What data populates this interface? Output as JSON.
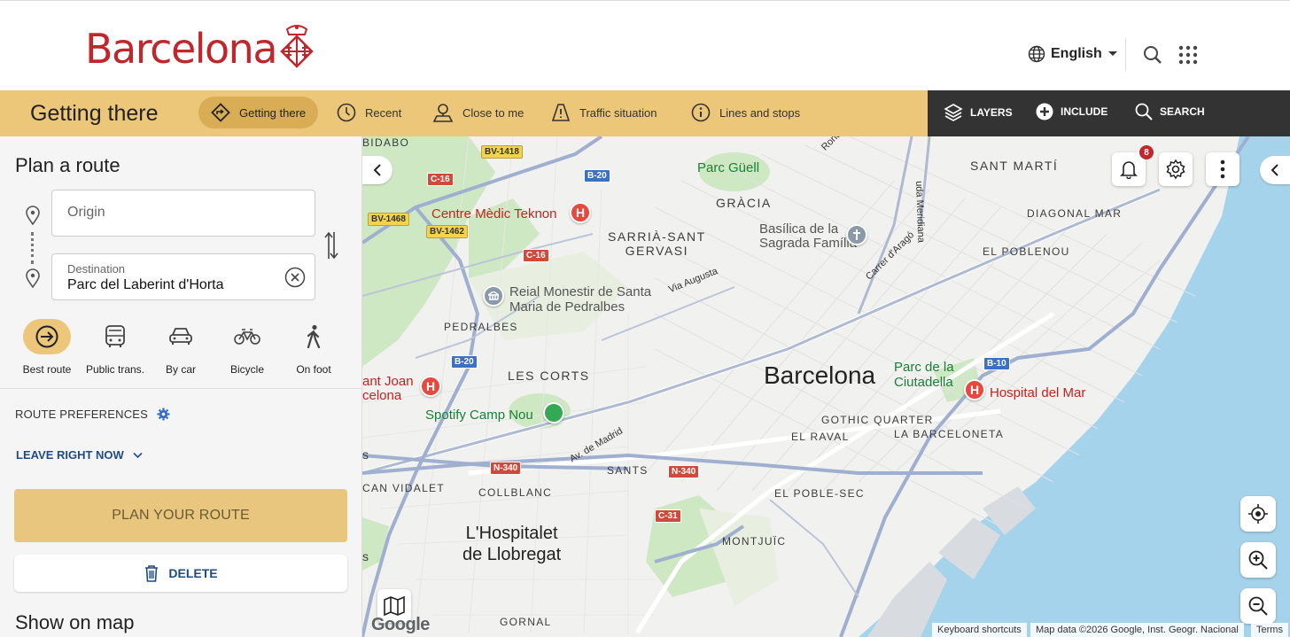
{
  "header": {
    "logo_text": "Barcelona",
    "language": "English"
  },
  "nav": {
    "title": "Getting there",
    "items": [
      {
        "label": "Getting there",
        "icon": "directions-icon",
        "active": true
      },
      {
        "label": "Recent",
        "icon": "clock-icon"
      },
      {
        "label": "Close to me",
        "icon": "person-pin-icon"
      },
      {
        "label": "Traffic situation",
        "icon": "traffic-cone-icon"
      },
      {
        "label": "Lines and stops",
        "icon": "info-icon"
      }
    ],
    "tools": [
      {
        "label": "LAYERS",
        "icon": "layers-icon"
      },
      {
        "label": "INCLUDE",
        "icon": "plus-circle-icon"
      },
      {
        "label": "SEARCH",
        "icon": "search-icon"
      }
    ]
  },
  "panel": {
    "title": "Plan a route",
    "origin_placeholder": "Origin",
    "destination_label": "Destination",
    "destination_value": "Parc del Laberint d'Horta",
    "modes": [
      {
        "label": "Best route",
        "icon": "best-route-icon",
        "active": true
      },
      {
        "label": "Public trans.",
        "icon": "bus-icon"
      },
      {
        "label": "By car",
        "icon": "car-icon"
      },
      {
        "label": "Bicycle",
        "icon": "bicycle-icon"
      },
      {
        "label": "On foot",
        "icon": "walking-icon"
      }
    ],
    "route_preferences": "ROUTE PREFERENCES",
    "leave": "LEAVE RIGHT NOW",
    "plan_button": "PLAN YOUR ROUTE",
    "delete_button": "DELETE",
    "show_on_map": "Show on map"
  },
  "map": {
    "notification_count": "8",
    "labels": {
      "bidabo": "BIDABO",
      "parc_guell": "Parc Güell",
      "ronda": "Ronda del G",
      "meridiana": "uda Meridiana",
      "sant_marti": "SANT MARTÍ",
      "gracia": "GRÀCIA",
      "diagonal_mar": "DIAGONAL MAR",
      "teknon": "Centre Mèdic Teknon",
      "sarria": "SARRIÀ-SANT\nGERVASI",
      "sagrada": "Basílica de la\nSagrada Família",
      "carrer_arago": "Carrer d'Aragó",
      "poblenou": "EL POBLENOU",
      "monestir": "Reial Monestir de Santa\nMaria de Pedralbes",
      "via_augusta": "Via Augusta",
      "pedralbes": "PEDRALBES",
      "les_corts": "LES CORTS",
      "barcelona": "Barcelona",
      "ciutadella": "Parc de la\nCiutadella",
      "hospital_mar": "Hospital del Mar",
      "sant_joan": "ant Joan\ncelona",
      "camp_nou": "Spotify Camp Nou",
      "av_madrid": "Av. de Madrid",
      "gothic": "GOTHIC QUARTER",
      "raval": "EL RAVAL",
      "barceloneta": "LA BARCELONETA",
      "s_left": "s",
      "sants": "SANTS",
      "can_vidalet": "CAN VIDALET",
      "collblanc": "COLLBLANC",
      "poble_sec": "EL POBLE-SEC",
      "hospitalet": "L'Hospitalet\nde Llobregat",
      "montjuic": "MONTJUÏC",
      "s_left2": "s",
      "gornal": "GORNAL"
    },
    "shields": {
      "bv1418": "BV-1418",
      "c16a": "C-16",
      "b20a": "B-20",
      "bv1468": "BV-1468",
      "bv1462": "BV-1462",
      "c16b": "C-16",
      "b20b": "B-20",
      "b10": "B-10",
      "n340a": "N-340",
      "n340b": "N-340",
      "c31": "C-31"
    },
    "google": "Google",
    "attribution": {
      "shortcuts": "Keyboard shortcuts",
      "data": "Map data ©2026 Google, Inst. Geogr. Nacional",
      "terms": "Terms"
    },
    "colors": {
      "sea": "#a6d3ec",
      "park": "#cfe8c4",
      "highway": "#aeb9d2",
      "brand_red": "#c0272d",
      "nav_yellow": "#ecc679"
    }
  }
}
